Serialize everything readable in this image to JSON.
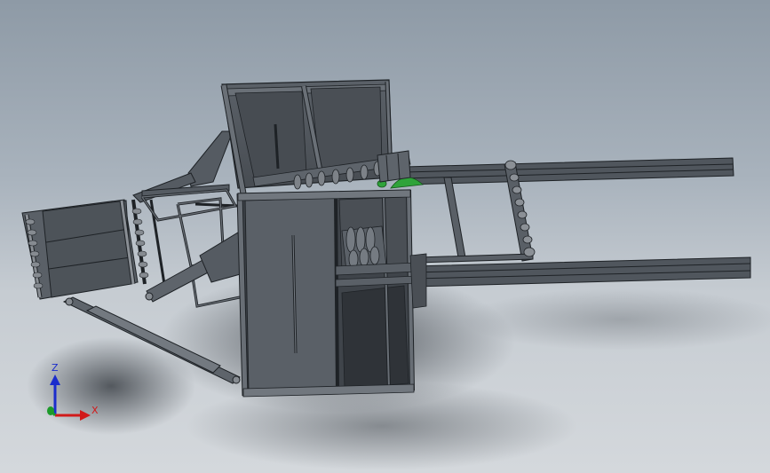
{
  "viewport": {
    "background_top": "#8e9aa6",
    "background_bottom": "#d4d8dc",
    "model_color": "#4e545b",
    "edge_color": "#1e2226",
    "accent_green": "#2fa33a"
  },
  "triad": {
    "z_label": "Z",
    "x_label": "X",
    "z_color": "#1b2ccc",
    "x_color": "#d11a1a",
    "y_color": "#1c9a2a"
  }
}
